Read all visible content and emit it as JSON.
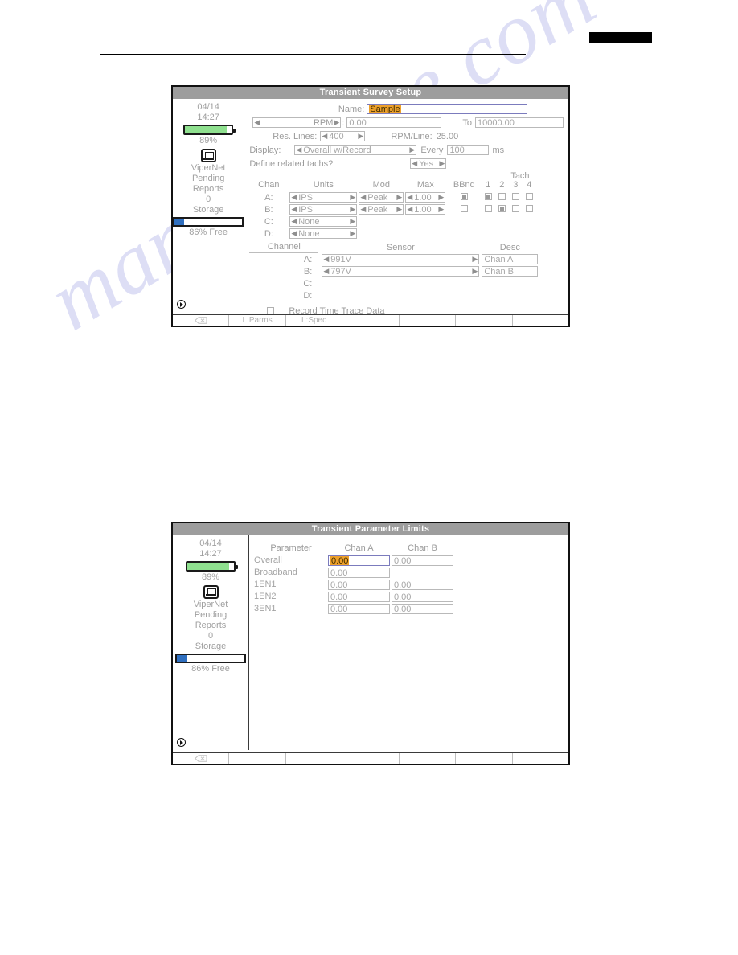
{
  "page": {
    "watermark_text": "manualshive.com",
    "redaction_bar": "",
    "accent_selection_color": "#eda02a",
    "focus_border_color": "#7b7bbd",
    "battery_color": "#8fe08f",
    "storage_color": "#2f6fbf"
  },
  "sidebar": {
    "date": "04/14",
    "time": "14:27",
    "battery_percent": "89%",
    "battery_level": 89,
    "network_icon": "ethernet-icon",
    "network_name": "ViperNet",
    "pending_label": "Pending",
    "reports_label": "Reports",
    "reports_count": "0",
    "storage_label": "Storage",
    "storage_free": "86% Free",
    "storage_used_level": 14,
    "power_icon": "power-play-icon"
  },
  "screen1": {
    "title": "Transient Survey Setup",
    "name_label": "Name:",
    "name_value": "Sample",
    "rpm_spinner_label": "RPM",
    "rpm_from_value": "0.00",
    "to_label": "To",
    "rpm_to_value": "10000.00",
    "res_lines_label": "Res. Lines:",
    "res_lines_value": "400",
    "rpm_per_line_label": "RPM/Line:",
    "rpm_per_line_value": "25.00",
    "display_label": "Display:",
    "display_value": "Overall w/Record",
    "every_label": "Every",
    "every_value": "100",
    "every_units": "ms",
    "define_tachs_label": "Define related tachs?",
    "define_tachs_value": "Yes",
    "chan_table": {
      "headers": {
        "chan": "Chan",
        "units": "Units",
        "mod": "Mod",
        "max": "Max",
        "bbnd": "BBnd",
        "tach_group": "Tach",
        "tach_1": "1",
        "tach_2": "2",
        "tach_3": "3",
        "tach_4": "4"
      },
      "rows": [
        {
          "chan": "A:",
          "units": "IPS",
          "mod": "Peak",
          "max": "1.00",
          "bbnd": true,
          "tach": [
            true,
            false,
            false,
            false
          ]
        },
        {
          "chan": "B:",
          "units": "IPS",
          "mod": "Peak",
          "max": "1.00",
          "bbnd": false,
          "tach": [
            false,
            true,
            false,
            false
          ]
        },
        {
          "chan": "C:",
          "units": "None",
          "mod": "",
          "max": "",
          "bbnd": null,
          "tach": []
        },
        {
          "chan": "D:",
          "units": "None",
          "mod": "",
          "max": "",
          "bbnd": null,
          "tach": []
        }
      ]
    },
    "sensor_table": {
      "headers": {
        "channel": "Channel",
        "sensor": "Sensor",
        "desc": "Desc"
      },
      "rows": [
        {
          "channel": "A:",
          "sensor": "991V",
          "desc": "Chan A"
        },
        {
          "channel": "B:",
          "sensor": "797V",
          "desc": "Chan B"
        },
        {
          "channel": "C:",
          "sensor": "",
          "desc": ""
        },
        {
          "channel": "D:",
          "sensor": "",
          "desc": ""
        }
      ]
    },
    "record_time_trace_label": "Record Time Trace Data",
    "record_time_trace_checked": false,
    "softkeys": [
      "",
      "L:Parms",
      "L:Spec",
      "",
      "",
      "",
      ""
    ]
  },
  "screen2": {
    "title": "Transient Parameter Limits",
    "table": {
      "headers": [
        "Parameter",
        "Chan A",
        "Chan B"
      ],
      "rows": [
        {
          "parameter": "Overall",
          "chan_a": "0.00",
          "chan_b": "0.00",
          "focused": true,
          "chan_b_present": true
        },
        {
          "parameter": "Broadband",
          "chan_a": "0.00",
          "chan_b": "",
          "focused": false,
          "chan_b_present": false
        },
        {
          "parameter": "1EN1",
          "chan_a": "0.00",
          "chan_b": "0.00",
          "focused": false,
          "chan_b_present": true
        },
        {
          "parameter": "1EN2",
          "chan_a": "0.00",
          "chan_b": "0.00",
          "focused": false,
          "chan_b_present": true
        },
        {
          "parameter": "3EN1",
          "chan_a": "0.00",
          "chan_b": "0.00",
          "focused": false,
          "chan_b_present": true
        }
      ]
    },
    "softkeys": [
      "",
      "",
      "",
      "",
      "",
      "",
      ""
    ]
  }
}
